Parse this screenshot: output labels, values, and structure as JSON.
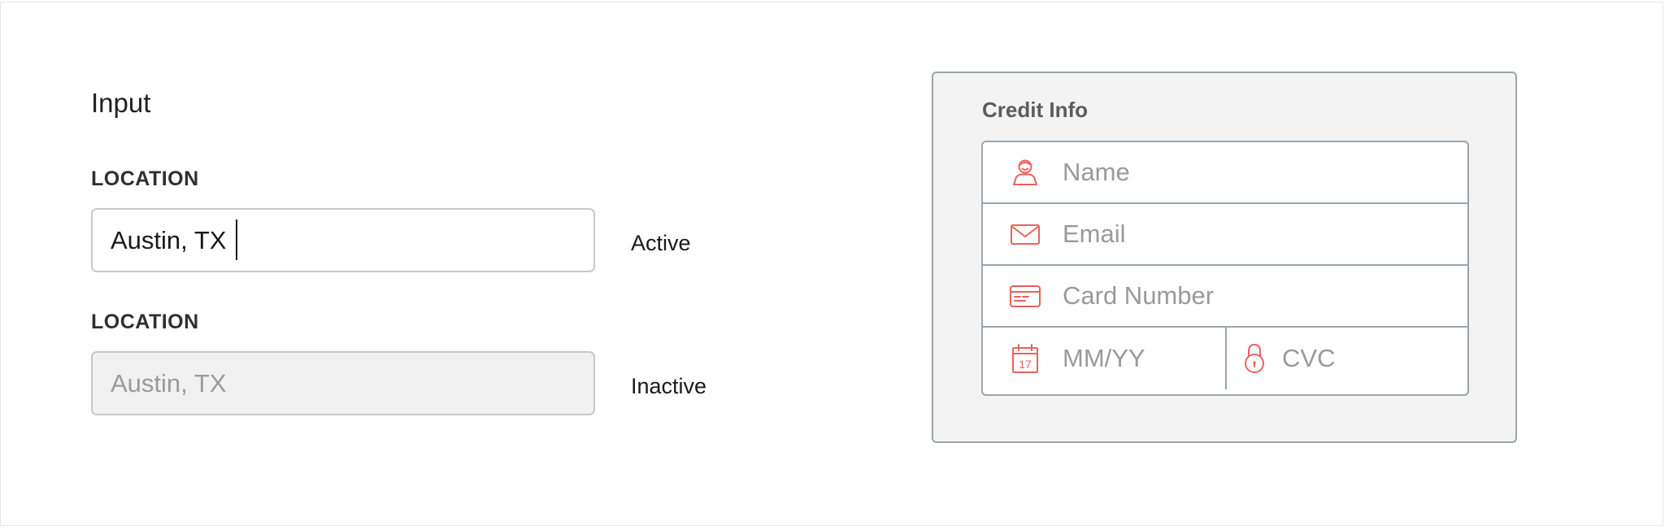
{
  "demo": {
    "title": "Input",
    "active": {
      "label": "LOCATION",
      "value": "Austin, TX",
      "state": "Active"
    },
    "inactive": {
      "label": "LOCATION",
      "value": "Austin, TX",
      "state": "Inactive"
    }
  },
  "credit": {
    "title": "Credit Info",
    "name_placeholder": "Name",
    "email_placeholder": "Email",
    "card_placeholder": "Card Number",
    "expiry_placeholder": "MM/YY",
    "calendar_day": "17",
    "cvc_placeholder": "CVC"
  },
  "colors": {
    "icon": "#e8625e",
    "border": "#9aa6ae",
    "card_bg": "#f3f3f3",
    "inactive_bg": "#f1f1f1"
  },
  "icons": {
    "name": "user-icon",
    "email": "envelope-icon",
    "card": "credit-card-icon",
    "expiry": "calendar-icon",
    "cvc": "padlock-icon"
  }
}
